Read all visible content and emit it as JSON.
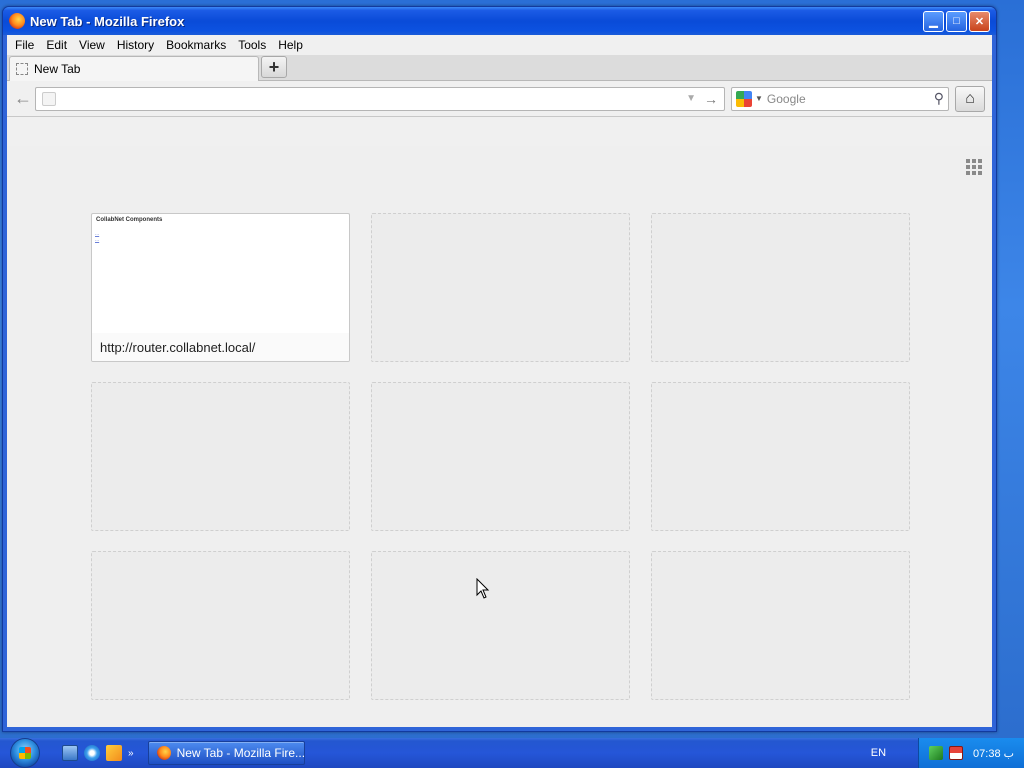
{
  "window": {
    "title": "New Tab - Mozilla Firefox",
    "controls": {
      "minimize": "▁",
      "maximize": "□",
      "close": "✕"
    }
  },
  "menubar": {
    "items": [
      "File",
      "Edit",
      "View",
      "History",
      "Bookmarks",
      "Tools",
      "Help"
    ]
  },
  "tabs": [
    {
      "label": "New Tab"
    }
  ],
  "newtab_label": "+",
  "navbar": {
    "url_value": "",
    "search_placeholder": "Google",
    "back_icon": "←",
    "go_icon": "→",
    "dropdown_icon": "▼",
    "home_icon": "⌂",
    "search_icon": "⚲"
  },
  "newtab_page": {
    "tiles": [
      {
        "filled": true,
        "url": "http://router.collabnet.local/",
        "thumb_title": "CollabNet Components",
        "thumb_links": [
          "...",
          "..."
        ]
      },
      {
        "filled": false
      },
      {
        "filled": false
      },
      {
        "filled": false
      },
      {
        "filled": false
      },
      {
        "filled": false
      },
      {
        "filled": false
      },
      {
        "filled": false
      },
      {
        "filled": false
      }
    ]
  },
  "taskbar": {
    "task_label": "New Tab - Mozilla Fire...",
    "more_arrow": "»",
    "language": "EN",
    "clock": "07:38 ب"
  }
}
